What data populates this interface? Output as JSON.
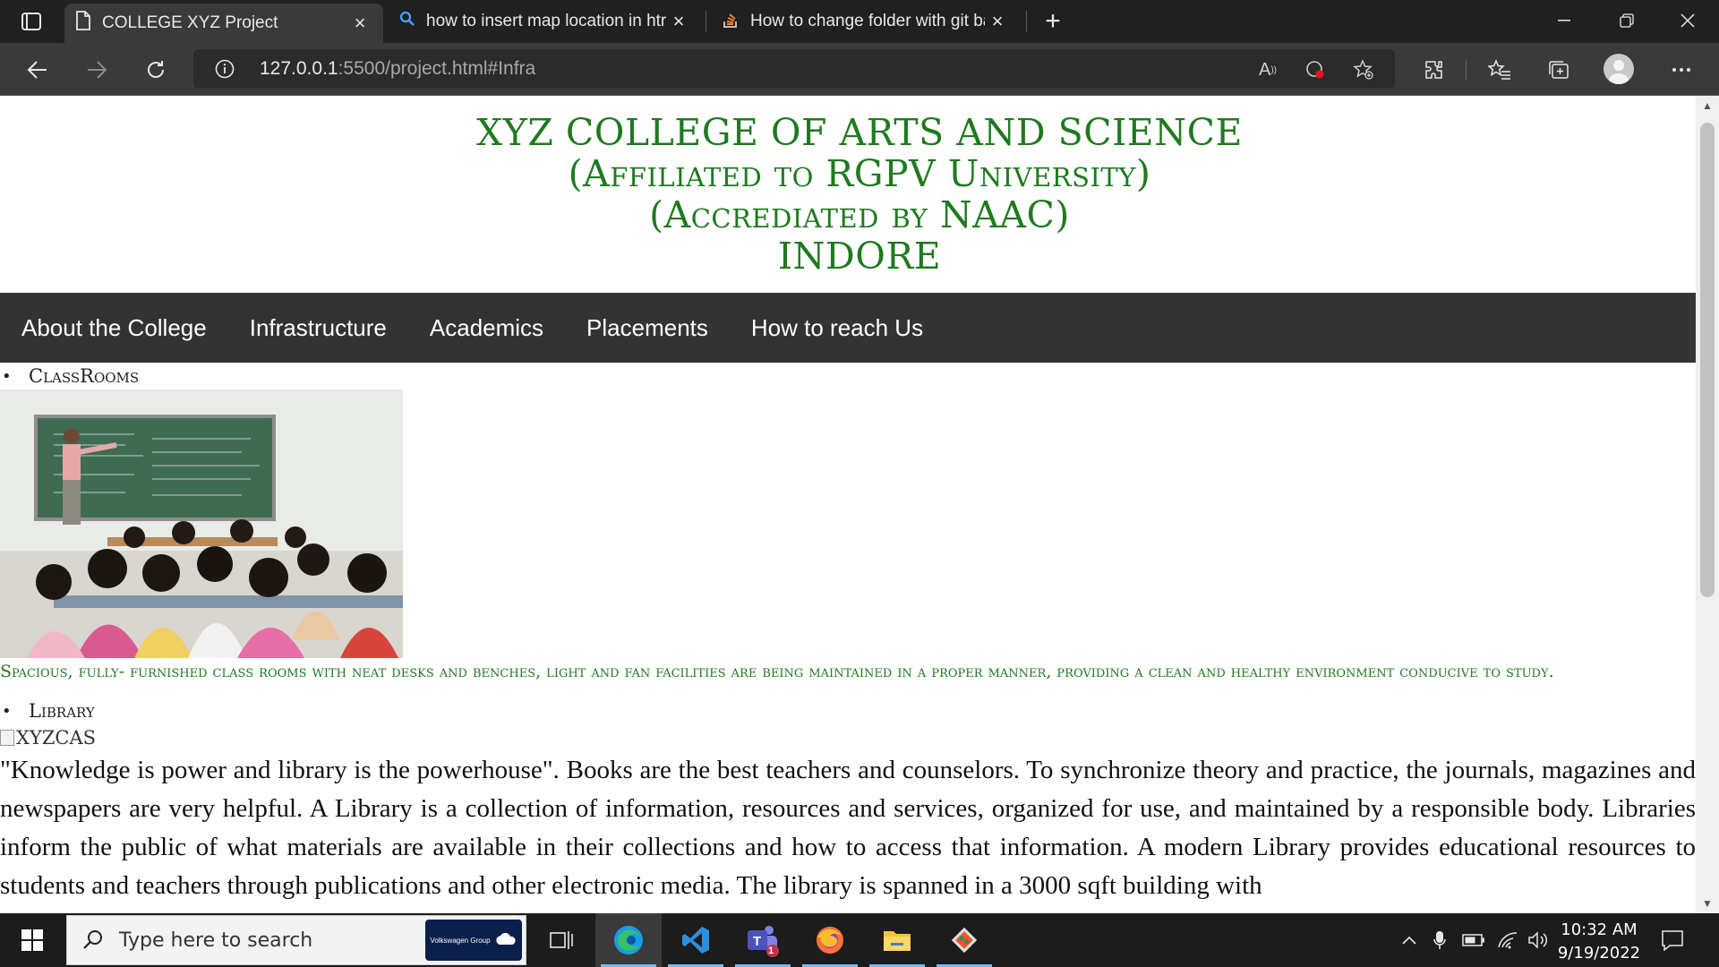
{
  "browser": {
    "tabs": [
      {
        "title": "COLLEGE XYZ Project",
        "icon": "page-icon",
        "active": true
      },
      {
        "title": "how to insert map location in htr",
        "icon": "search-icon",
        "active": false
      },
      {
        "title": "How to change folder with git ba",
        "icon": "stackoverflow-icon",
        "active": false
      }
    ],
    "address": {
      "host": "127.0.0.1",
      "rest": ":5500/project.html#Infra"
    }
  },
  "page": {
    "header_lines": [
      "XYZ COLLEGE OF ARTS AND SCIENCE",
      "(Affiliated to RGPV University)",
      "(Accrediated by NAAC)",
      "INDORE"
    ],
    "nav": [
      "About the College",
      "Infrastructure",
      "Academics",
      "Placements",
      "How to reach Us"
    ],
    "sections": {
      "classrooms_title": "ClassRooms",
      "classrooms_caption": "Spacious, fully- furnished class rooms with neat desks and benches, light and fan facilities are being maintained in a proper manner, providing a clean and healthy environment conducive to study.",
      "library_title": "Library",
      "library_img_alt": "XYZCAS",
      "library_text": "\"Knowledge is power and library is the powerhouse\". Books are the best teachers and counselors. To synchronize theory and practice, the journals, magazines and newspapers are very helpful. A Library is a collection of information, resources and services, organized for use, and maintained by a responsible body. Libraries inform the public of what materials are available in their collections and how to access that information. A modern Library provides educational resources to students and teachers through publications and other electronic media. The library is spanned in a 3000 sqft building with"
    }
  },
  "taskbar": {
    "search_placeholder": "Type here to search",
    "promo_text": "Volkswagen Group",
    "teams_badge": "1",
    "time": "10:32 AM",
    "date": "9/19/2022"
  },
  "colors": {
    "header_green": "#1e7a1e",
    "nav_bg": "#333333"
  }
}
